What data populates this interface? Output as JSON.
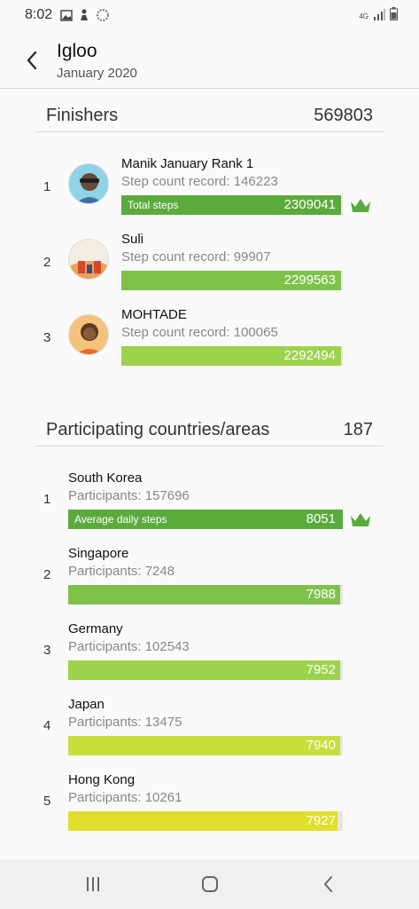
{
  "status": {
    "time": "8:02",
    "network": "4G"
  },
  "header": {
    "title": "Igloo",
    "subtitle": "January 2020"
  },
  "finishers": {
    "label": "Finishers",
    "total": "569803",
    "bar_caption": "Total steps",
    "items": [
      {
        "rank": "1",
        "name": "Manik January Rank 1",
        "record": "Step count record: 146223",
        "steps": "2309041",
        "fraction": 0.99,
        "color": "#5aab3c"
      },
      {
        "rank": "2",
        "name": "Suli",
        "record": "Step count record: 99907",
        "steps": "2299563",
        "fraction": 0.99,
        "color": "#7ec24a"
      },
      {
        "rank": "3",
        "name": "MOHTADE",
        "record": "Step count record: 100065",
        "steps": "2292494",
        "fraction": 0.99,
        "color": "#9dd24c"
      }
    ]
  },
  "countries": {
    "label": "Participating countries/areas",
    "total": "187",
    "bar_caption": "Average daily steps",
    "items": [
      {
        "rank": "1",
        "name": "South Korea",
        "participants": "Participants: 157696",
        "steps": "8051",
        "fraction": 1.0,
        "color": "#5aab3c"
      },
      {
        "rank": "2",
        "name": "Singapore",
        "participants": "Participants: 7248",
        "steps": "7988",
        "fraction": 0.99,
        "color": "#7ec24a"
      },
      {
        "rank": "3",
        "name": "Germany",
        "participants": "Participants: 102543",
        "steps": "7952",
        "fraction": 0.99,
        "color": "#9dd24c"
      },
      {
        "rank": "4",
        "name": "Japan",
        "participants": "Participants: 13475",
        "steps": "7940",
        "fraction": 0.99,
        "color": "#c8de3a"
      },
      {
        "rank": "5",
        "name": "Hong Kong",
        "participants": "Participants: 10261",
        "steps": "7927",
        "fraction": 0.98,
        "color": "#e2de2e"
      }
    ]
  },
  "colors": {
    "crown": "#5aab3c"
  }
}
